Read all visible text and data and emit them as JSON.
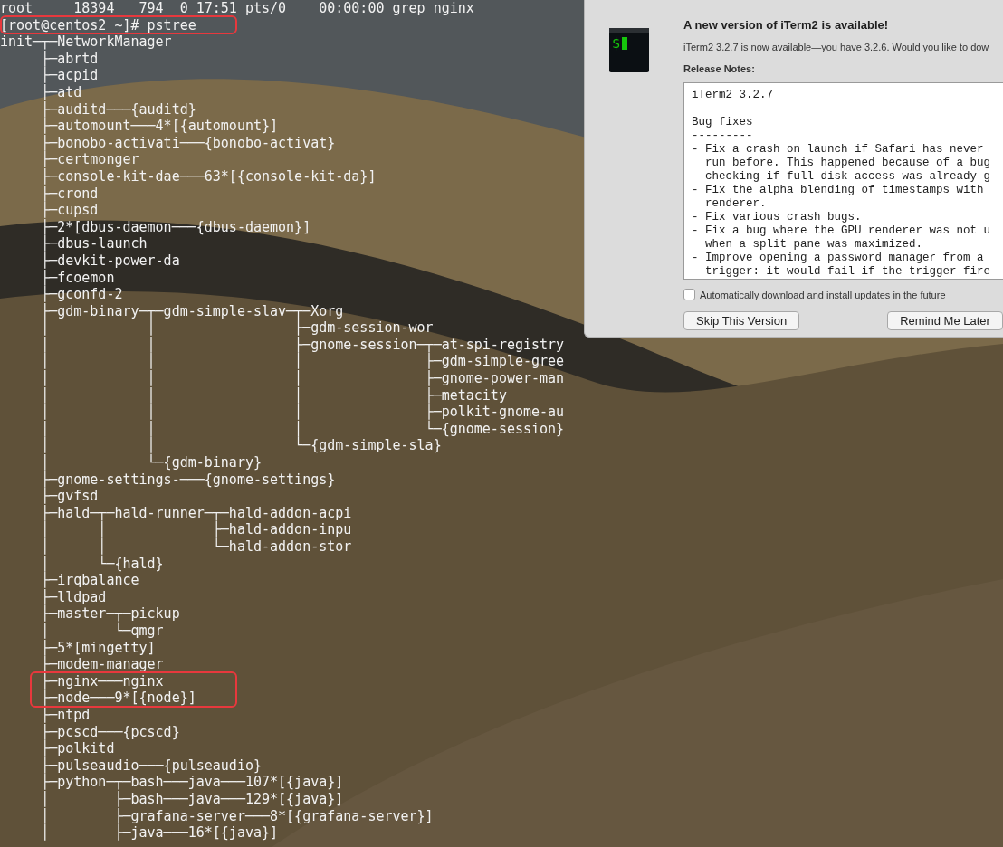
{
  "terminal": {
    "lines": [
      {
        "text": "root     18394   794  0 17:51 pts/0    00:00:00 grep nginx",
        "highlighted": false
      },
      {
        "text": "[root@centos2 ~]# pstree",
        "highlighted": true
      },
      {
        "text": "init─┬─NetworkManager",
        "highlighted": false
      },
      {
        "text": "     ├─abrtd",
        "highlighted": false
      },
      {
        "text": "     ├─acpid",
        "highlighted": false
      },
      {
        "text": "     ├─atd",
        "highlighted": false
      },
      {
        "text": "     ├─auditd───{auditd}",
        "highlighted": false
      },
      {
        "text": "     ├─automount───4*[{automount}]",
        "highlighted": false
      },
      {
        "text": "     ├─bonobo-activati───{bonobo-activat}",
        "highlighted": false
      },
      {
        "text": "     ├─certmonger",
        "highlighted": false
      },
      {
        "text": "     ├─console-kit-dae───63*[{console-kit-da}]",
        "highlighted": false
      },
      {
        "text": "     ├─crond",
        "highlighted": false
      },
      {
        "text": "     ├─cupsd",
        "highlighted": false
      },
      {
        "text": "     ├─2*[dbus-daemon───{dbus-daemon}]",
        "highlighted": false
      },
      {
        "text": "     ├─dbus-launch",
        "highlighted": false
      },
      {
        "text": "     ├─devkit-power-da",
        "highlighted": false
      },
      {
        "text": "     ├─fcoemon",
        "highlighted": false
      },
      {
        "text": "     ├─gconfd-2",
        "highlighted": false
      },
      {
        "text": "     ├─gdm-binary─┬─gdm-simple-slav─┬─Xorg",
        "highlighted": false
      },
      {
        "text": "     │            │                 ├─gdm-session-wor",
        "highlighted": false
      },
      {
        "text": "     │            │                 ├─gnome-session─┬─at-spi-registry",
        "highlighted": false
      },
      {
        "text": "     │            │                 │               ├─gdm-simple-gree",
        "highlighted": false
      },
      {
        "text": "     │            │                 │               ├─gnome-power-man",
        "highlighted": false
      },
      {
        "text": "     │            │                 │               ├─metacity",
        "highlighted": false
      },
      {
        "text": "     │            │                 │               ├─polkit-gnome-au",
        "highlighted": false
      },
      {
        "text": "     │            │                 │               └─{gnome-session}",
        "highlighted": false
      },
      {
        "text": "     │            │                 └─{gdm-simple-sla}",
        "highlighted": false
      },
      {
        "text": "     │            └─{gdm-binary}",
        "highlighted": false
      },
      {
        "text": "     ├─gnome-settings-───{gnome-settings}",
        "highlighted": false
      },
      {
        "text": "     ├─gvfsd",
        "highlighted": false
      },
      {
        "text": "     ├─hald─┬─hald-runner─┬─hald-addon-acpi",
        "highlighted": false
      },
      {
        "text": "     │      │             ├─hald-addon-inpu",
        "highlighted": false
      },
      {
        "text": "     │      │             └─hald-addon-stor",
        "highlighted": false
      },
      {
        "text": "     │      └─{hald}",
        "highlighted": false
      },
      {
        "text": "     ├─irqbalance",
        "highlighted": false
      },
      {
        "text": "     ├─lldpad",
        "highlighted": false
      },
      {
        "text": "     ├─master─┬─pickup",
        "highlighted": false
      },
      {
        "text": "     │        └─qmgr",
        "highlighted": false
      },
      {
        "text": "     ├─5*[mingetty]",
        "highlighted": false
      },
      {
        "text": "     ├─modem-manager",
        "highlighted": false
      },
      {
        "text": "     ├─nginx───nginx",
        "highlighted": true
      },
      {
        "text": "     ├─node───9*[{node}]",
        "highlighted": true
      },
      {
        "text": "     ├─ntpd",
        "highlighted": false
      },
      {
        "text": "     ├─pcscd───{pcscd}",
        "highlighted": false
      },
      {
        "text": "     ├─polkitd",
        "highlighted": false
      },
      {
        "text": "     ├─pulseaudio───{pulseaudio}",
        "highlighted": false
      },
      {
        "text": "     ├─python─┬─bash───java───107*[{java}]",
        "highlighted": false
      },
      {
        "text": "     │        ├─bash───java───129*[{java}]",
        "highlighted": false
      },
      {
        "text": "     │        ├─grafana-server───8*[{grafana-server}]",
        "highlighted": false
      },
      {
        "text": "     │        ├─java───16*[{java}]",
        "highlighted": false
      }
    ]
  },
  "update_dialog": {
    "title": "A new version of iTerm2 is available!",
    "message": "iTerm2 3.2.7 is now available—you have 3.2.6. Would you like to dow",
    "notes_label": "Release Notes:",
    "app_icon": {
      "glyph": "$"
    },
    "notes": [
      [
        "iTerm2 3.2.7"
      ],
      [
        "Bug fixes",
        "---------",
        "- Fix a crash on launch if Safari has never",
        "  run before. This happened because of a bug",
        "  checking if full disk access was already g",
        "- Fix the alpha blending of timestamps with",
        "  renderer.",
        "- Fix various crash bugs.",
        "- Fix a bug where the GPU renderer was not u",
        "  when a split pane was maximized.",
        "- Improve opening a password manager from a",
        "  trigger: it would fail if the trigger fire"
      ]
    ],
    "auto_update": {
      "label": "Automatically download and install updates in the future",
      "checked": false
    },
    "buttons": [
      "Skip This Version",
      "Remind Me Later"
    ]
  }
}
